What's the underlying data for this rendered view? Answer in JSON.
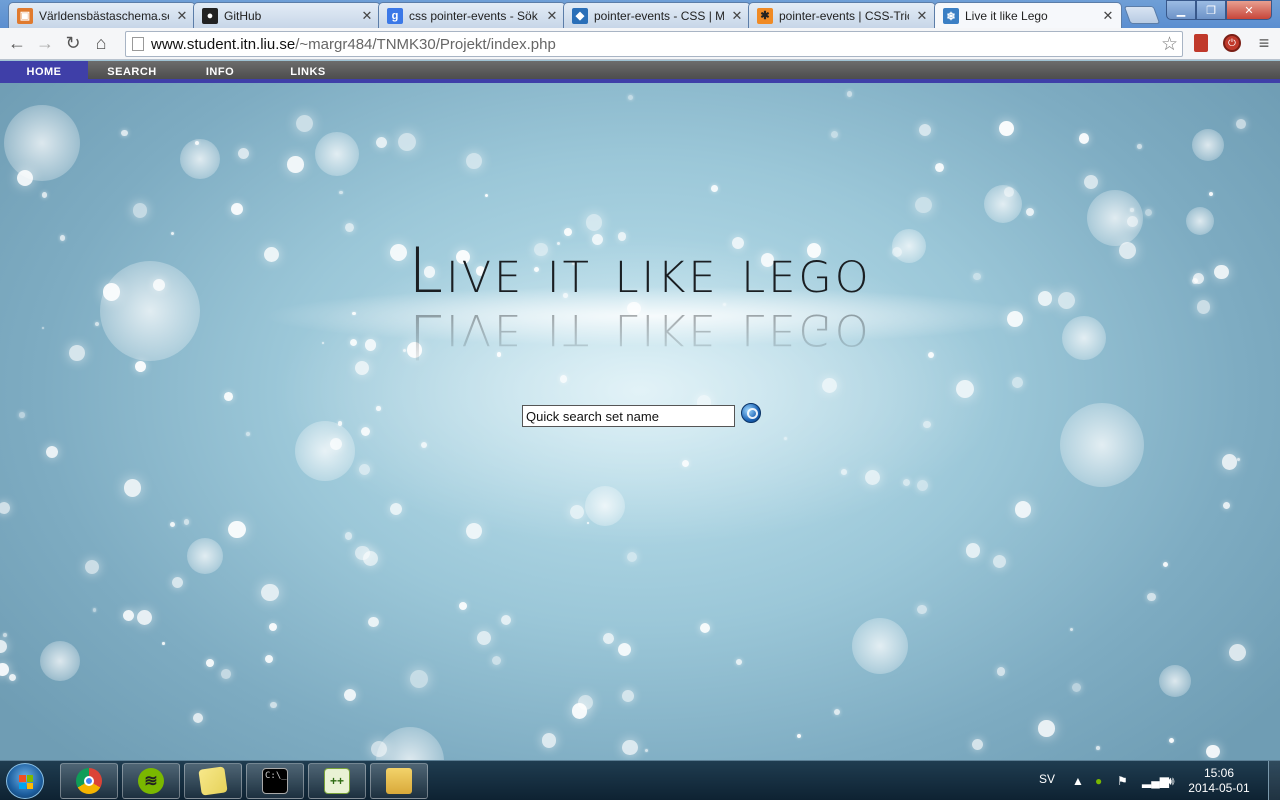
{
  "tabs": [
    {
      "title": "Världensbästaschema.se",
      "favicon": "schema-icon",
      "color": "#e07a2e"
    },
    {
      "title": "GitHub",
      "favicon": "github-icon",
      "color": "#222222"
    },
    {
      "title": "css pointer-events - Sök p",
      "favicon": "google-icon",
      "color": "#3b78e7"
    },
    {
      "title": "pointer-events - CSS | MD",
      "favicon": "mdn-icon",
      "color": "#2a6fb8"
    },
    {
      "title": "pointer-events | CSS-Tric",
      "favicon": "css-tricks-icon",
      "color": "#f08a24"
    },
    {
      "title": "Live it like Lego",
      "favicon": "snowflake-icon",
      "color": "#3b7fc4",
      "active": true
    }
  ],
  "address_bar": {
    "host": "www.student.itn.liu.se",
    "path": "/~margr484/TNMK30/Projekt/index.php"
  },
  "site_nav": {
    "items": [
      {
        "label": "HOME",
        "active": true
      },
      {
        "label": "SEARCH",
        "active": false
      },
      {
        "label": "INFO",
        "active": false
      },
      {
        "label": "LINKS",
        "active": false
      }
    ],
    "active_color": "#3f3fa8"
  },
  "hero": {
    "title": "Live it like lego"
  },
  "search": {
    "value": "Quick search set name"
  },
  "taskbar": {
    "apps": [
      "chrome-icon",
      "spotify-icon",
      "sticky-notes-icon",
      "command-prompt-icon",
      "notepad-plus-icon",
      "file-explorer-icon"
    ],
    "language": "SV",
    "time": "15:06",
    "date": "2014-05-01"
  }
}
